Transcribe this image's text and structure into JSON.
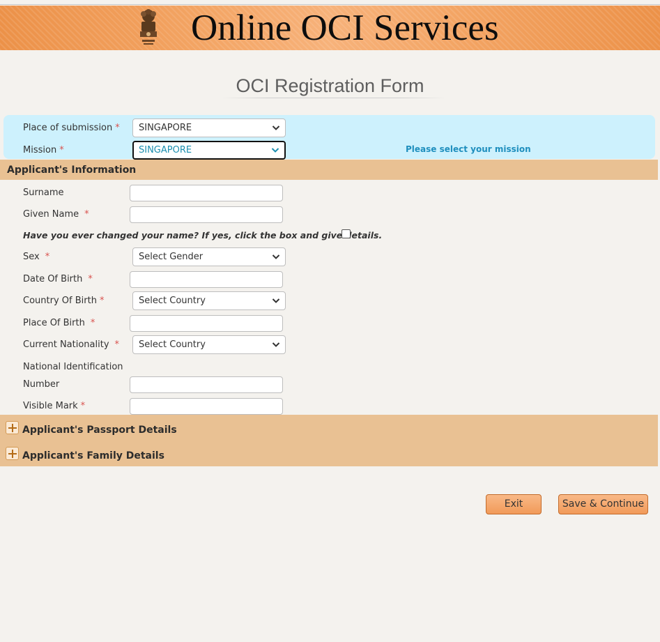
{
  "header": {
    "title": "Online OCI Services"
  },
  "form": {
    "title": "OCI Registration Form"
  },
  "mission": {
    "place_label": "Place of submission",
    "place_value": "SINGAPORE",
    "mission_label": "Mission",
    "mission_value": "SINGAPORE",
    "hint": "Please select your mission",
    "required_mark": "*"
  },
  "applicant": {
    "heading": "Applicant's Information",
    "surname_label": "Surname",
    "given_name_label": "Given Name",
    "name_change_question": "Have you ever changed your name? If yes, click the box and give details.",
    "sex_label": "Sex",
    "sex_value": "Select Gender",
    "dob_label": "Date Of Birth",
    "country_birth_label": "Country Of Birth",
    "country_birth_value": "Select Country",
    "place_birth_label": "Place Of Birth",
    "nationality_label": "Current Nationality",
    "nationality_value": "Select Country",
    "national_id_label_line1": "National Identification",
    "national_id_label_line2": "Number",
    "visible_mark_label": "Visible Mark",
    "required_mark": "*"
  },
  "sections": {
    "passport": "Applicant's Passport Details",
    "family": "Applicant's Family Details"
  },
  "buttons": {
    "exit": "Exit",
    "save_continue": "Save & Continue"
  },
  "colors": {
    "banner": "#f3a463",
    "section_bar": "#e9c193",
    "mission_box": "#cdf1fd",
    "hint": "#1f8fbe",
    "required": "#d9534f"
  }
}
